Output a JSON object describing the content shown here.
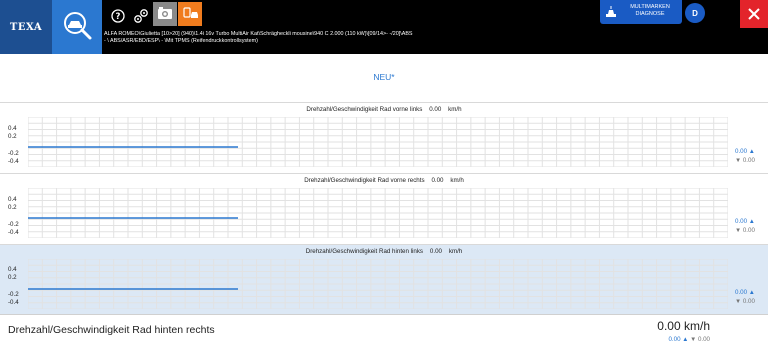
{
  "header": {
    "logo_text": "TEXA",
    "vehicle_line1": "ALFA ROMEO\\Giulietta [10>20] (940)\\1.4i 16v Turbo MultiAir Kat\\Schrägheckli mousine\\940 C 2.000 (110 kW)\\[09/14>- -/20]\\ABS",
    "vehicle_line2": "- \\ ABS/ASR/EBD/ESP\\ - \\Mit TPMS (Reifendruckkontrollsystem)",
    "multi_button_line1": "MULTIMARKEN",
    "multi_button_line2": "DIAGNOSE",
    "avatar_letter": "D",
    "icons": [
      "car-diagnosis-icon",
      "help-icon",
      "settings-gears-icon",
      "camera-icon",
      "car-transfer-icon",
      "multibrand-icon",
      "close-icon"
    ],
    "colors": {
      "logo_bg": "#1d4f91",
      "active_blue": "#2b78d0",
      "orange": "#f07c1e",
      "close_red": "#e3242b"
    }
  },
  "page_title": "NEU*",
  "panels": [
    {
      "label": "Drehzahl/Geschwindigkeit Rad vorne links",
      "value": "0.00",
      "unit": "km/h",
      "y_ticks": [
        "0.4",
        "0.2",
        "-0.2",
        "-0.4"
      ],
      "max": "0.00 ▲",
      "min": "▼ 0.00",
      "level": 0.0,
      "selected": false
    },
    {
      "label": "Drehzahl/Geschwindigkeit Rad vorne rechts",
      "value": "0.00",
      "unit": "km/h",
      "y_ticks": [
        "0.4",
        "0.2",
        "-0.2",
        "-0.4"
      ],
      "max": "0.00 ▲",
      "min": "▼ 0.00",
      "level": 0.0,
      "selected": false
    },
    {
      "label": "Drehzahl/Geschwindigkeit Rad hinten links",
      "value": "0.00",
      "unit": "km/h",
      "y_ticks": [
        "0.4",
        "0.2",
        "-0.2",
        "-0.4"
      ],
      "max": "0.00 ▲",
      "min": "▼ 0.00",
      "level": 0.0,
      "selected": true
    }
  ],
  "bottom": {
    "label": "Drehzahl/Geschwindigkeit Rad hinten rechts",
    "value": "0.00 km/h",
    "max": "0.00 ▲",
    "min": "▼ 0.00"
  }
}
